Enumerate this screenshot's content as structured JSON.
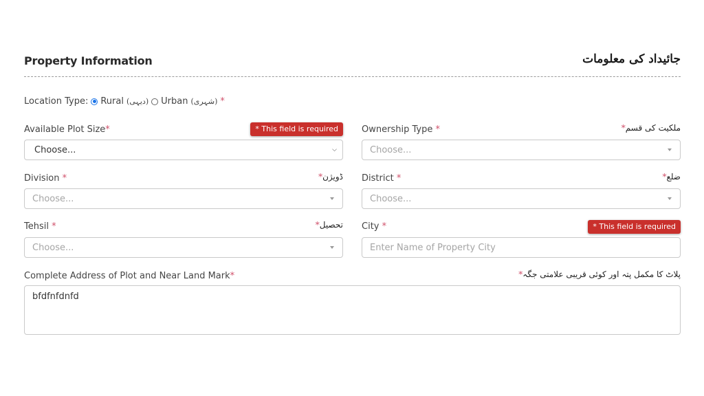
{
  "section": {
    "title": "Property Information",
    "title_ur": "جائیداد کی معلومات"
  },
  "location_type": {
    "label": "Location Type:",
    "options": [
      {
        "label": "Rural",
        "label_ur": "(دیہی)",
        "checked": true
      },
      {
        "label": "Urban",
        "label_ur": "(شہری)",
        "checked": false
      }
    ],
    "required_mark": "*"
  },
  "fields": {
    "plot_size": {
      "label": "Available Plot Size",
      "required_mark": "*",
      "value": "Choose...",
      "error": "* This field is required"
    },
    "ownership_type": {
      "label": "Ownership Type",
      "required_mark": "*",
      "label_ur": "ملکیت کی قسم",
      "placeholder": "Choose..."
    },
    "division": {
      "label": "Division",
      "required_mark": "*",
      "label_ur": "ڈویژن",
      "placeholder": "Choose..."
    },
    "district": {
      "label": "District",
      "required_mark": "*",
      "label_ur": "ضلع",
      "placeholder": "Choose..."
    },
    "tehsil": {
      "label": "Tehsil",
      "required_mark": "*",
      "label_ur": "تحصیل",
      "placeholder": "Choose..."
    },
    "city": {
      "label": "City",
      "required_mark": "*",
      "placeholder": "Enter Name of Property City",
      "value": "",
      "error": "* This field is required"
    },
    "address": {
      "label": "Complete Address of Plot and Near Land Mark",
      "required_mark": "*",
      "label_ur": "پلاٹ کا مکمل پتہ اور کوئی قریبی علامتی جگہ",
      "value": "bfdfnfdnfd"
    }
  },
  "colors": {
    "error_badge": "#c9302c",
    "required_star": "#d0506a",
    "radio_accent": "#1a73e8"
  }
}
